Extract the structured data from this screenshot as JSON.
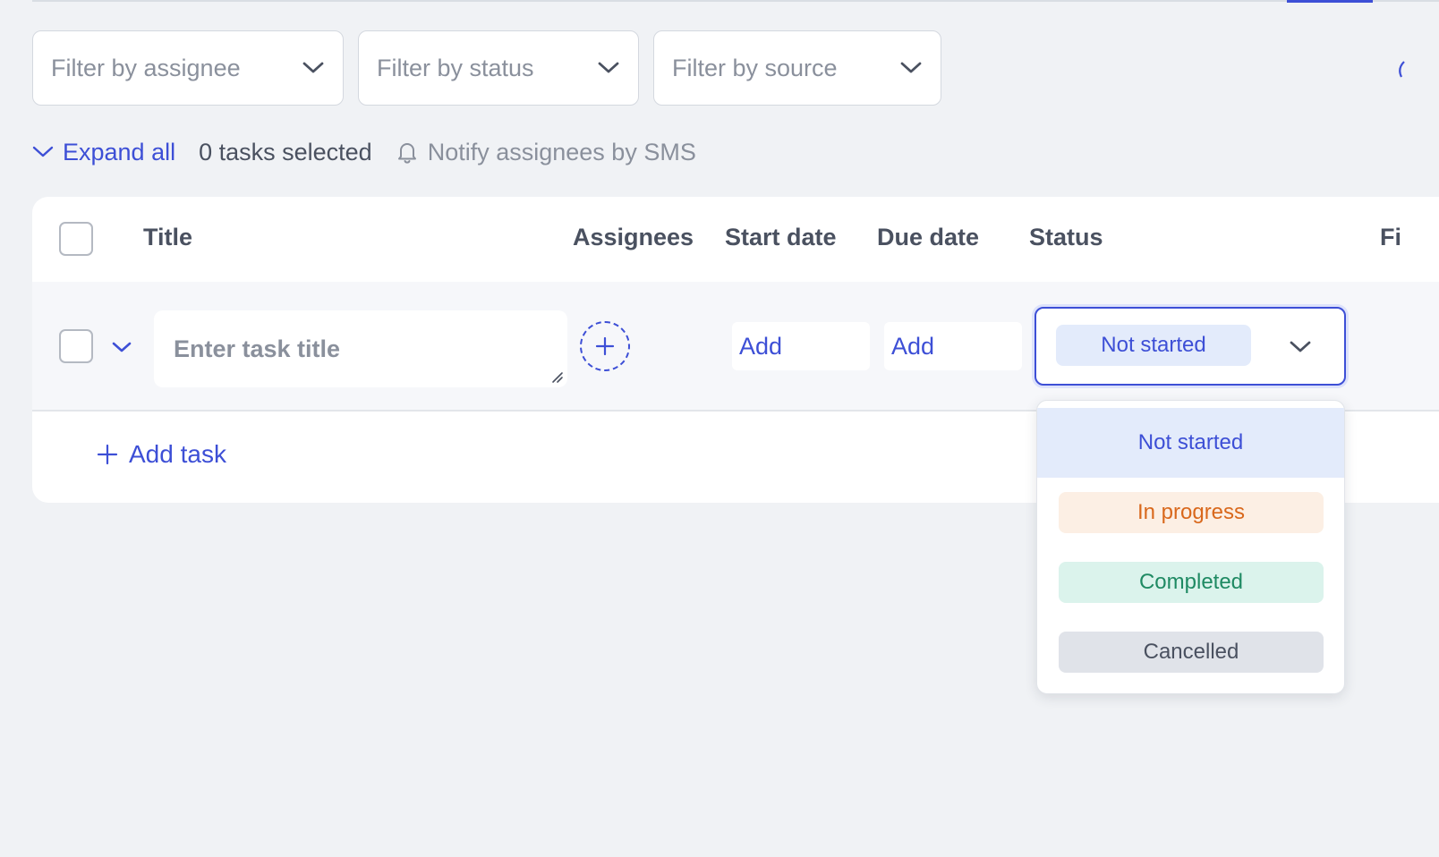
{
  "filters": {
    "assignee": "Filter by assignee",
    "status": "Filter by status",
    "source": "Filter by source"
  },
  "toolbar": {
    "expand_all": "Expand all",
    "tasks_selected": "0 tasks selected",
    "notify": "Notify assignees by SMS"
  },
  "table": {
    "columns": [
      "Title",
      "Assignees",
      "Start date",
      "Due date",
      "Status",
      "Fi"
    ]
  },
  "task_row": {
    "title_placeholder": "Enter task title",
    "start_date": "Add",
    "due_date": "Add",
    "status": "Not started"
  },
  "add_task": "Add task",
  "status_dropdown": {
    "options": [
      "Not started",
      "In progress",
      "Completed",
      "Cancelled"
    ],
    "selected": "Not started"
  },
  "colors": {
    "accent": "#3d4fd6",
    "not_started_bg": "#e3ebfb",
    "in_progress_bg": "#fcefe4",
    "in_progress_text": "#d9681c",
    "completed_bg": "#dbf3ec",
    "completed_text": "#1f8a63",
    "cancelled_bg": "#e0e3e9"
  },
  "icons": {
    "filter_chevron": "chevron-down-icon",
    "expand": "chevron-down-icon",
    "notify": "bell-icon",
    "assignee_add": "plus-icon",
    "add_task": "plus-icon",
    "resize": "resize-grip-icon"
  }
}
